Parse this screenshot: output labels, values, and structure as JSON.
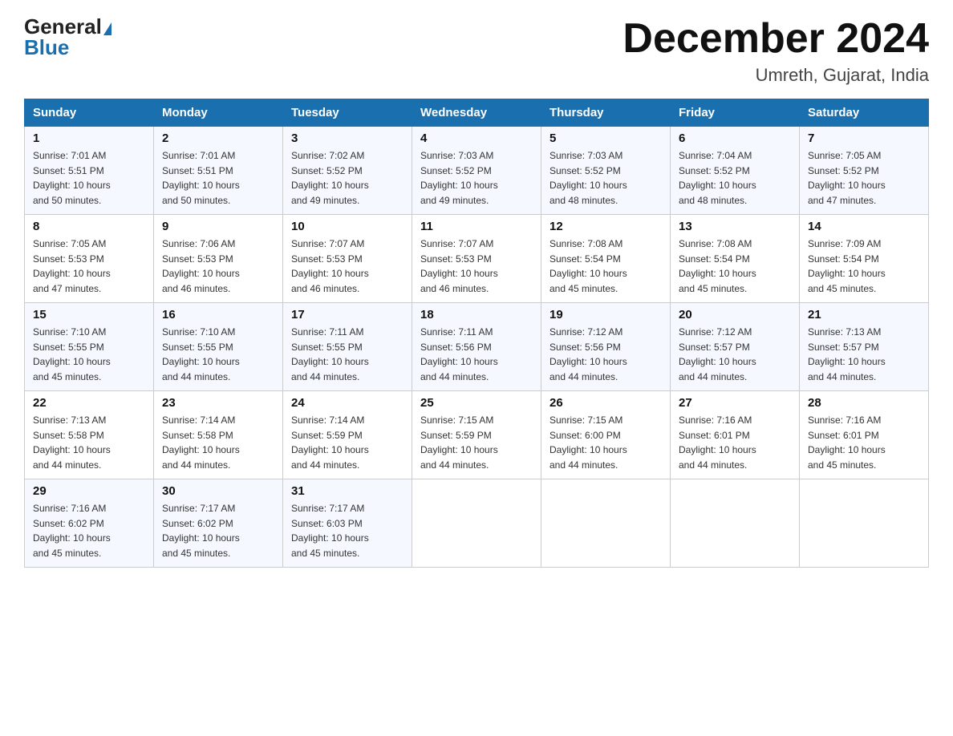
{
  "header": {
    "logo_general": "General",
    "logo_blue": "Blue",
    "month_title": "December 2024",
    "location": "Umreth, Gujarat, India"
  },
  "weekdays": [
    "Sunday",
    "Monday",
    "Tuesday",
    "Wednesday",
    "Thursday",
    "Friday",
    "Saturday"
  ],
  "weeks": [
    [
      {
        "day": "1",
        "sunrise": "7:01 AM",
        "sunset": "5:51 PM",
        "daylight": "10 hours and 50 minutes."
      },
      {
        "day": "2",
        "sunrise": "7:01 AM",
        "sunset": "5:51 PM",
        "daylight": "10 hours and 50 minutes."
      },
      {
        "day": "3",
        "sunrise": "7:02 AM",
        "sunset": "5:52 PM",
        "daylight": "10 hours and 49 minutes."
      },
      {
        "day": "4",
        "sunrise": "7:03 AM",
        "sunset": "5:52 PM",
        "daylight": "10 hours and 49 minutes."
      },
      {
        "day": "5",
        "sunrise": "7:03 AM",
        "sunset": "5:52 PM",
        "daylight": "10 hours and 48 minutes."
      },
      {
        "day": "6",
        "sunrise": "7:04 AM",
        "sunset": "5:52 PM",
        "daylight": "10 hours and 48 minutes."
      },
      {
        "day": "7",
        "sunrise": "7:05 AM",
        "sunset": "5:52 PM",
        "daylight": "10 hours and 47 minutes."
      }
    ],
    [
      {
        "day": "8",
        "sunrise": "7:05 AM",
        "sunset": "5:53 PM",
        "daylight": "10 hours and 47 minutes."
      },
      {
        "day": "9",
        "sunrise": "7:06 AM",
        "sunset": "5:53 PM",
        "daylight": "10 hours and 46 minutes."
      },
      {
        "day": "10",
        "sunrise": "7:07 AM",
        "sunset": "5:53 PM",
        "daylight": "10 hours and 46 minutes."
      },
      {
        "day": "11",
        "sunrise": "7:07 AM",
        "sunset": "5:53 PM",
        "daylight": "10 hours and 46 minutes."
      },
      {
        "day": "12",
        "sunrise": "7:08 AM",
        "sunset": "5:54 PM",
        "daylight": "10 hours and 45 minutes."
      },
      {
        "day": "13",
        "sunrise": "7:08 AM",
        "sunset": "5:54 PM",
        "daylight": "10 hours and 45 minutes."
      },
      {
        "day": "14",
        "sunrise": "7:09 AM",
        "sunset": "5:54 PM",
        "daylight": "10 hours and 45 minutes."
      }
    ],
    [
      {
        "day": "15",
        "sunrise": "7:10 AM",
        "sunset": "5:55 PM",
        "daylight": "10 hours and 45 minutes."
      },
      {
        "day": "16",
        "sunrise": "7:10 AM",
        "sunset": "5:55 PM",
        "daylight": "10 hours and 44 minutes."
      },
      {
        "day": "17",
        "sunrise": "7:11 AM",
        "sunset": "5:55 PM",
        "daylight": "10 hours and 44 minutes."
      },
      {
        "day": "18",
        "sunrise": "7:11 AM",
        "sunset": "5:56 PM",
        "daylight": "10 hours and 44 minutes."
      },
      {
        "day": "19",
        "sunrise": "7:12 AM",
        "sunset": "5:56 PM",
        "daylight": "10 hours and 44 minutes."
      },
      {
        "day": "20",
        "sunrise": "7:12 AM",
        "sunset": "5:57 PM",
        "daylight": "10 hours and 44 minutes."
      },
      {
        "day": "21",
        "sunrise": "7:13 AM",
        "sunset": "5:57 PM",
        "daylight": "10 hours and 44 minutes."
      }
    ],
    [
      {
        "day": "22",
        "sunrise": "7:13 AM",
        "sunset": "5:58 PM",
        "daylight": "10 hours and 44 minutes."
      },
      {
        "day": "23",
        "sunrise": "7:14 AM",
        "sunset": "5:58 PM",
        "daylight": "10 hours and 44 minutes."
      },
      {
        "day": "24",
        "sunrise": "7:14 AM",
        "sunset": "5:59 PM",
        "daylight": "10 hours and 44 minutes."
      },
      {
        "day": "25",
        "sunrise": "7:15 AM",
        "sunset": "5:59 PM",
        "daylight": "10 hours and 44 minutes."
      },
      {
        "day": "26",
        "sunrise": "7:15 AM",
        "sunset": "6:00 PM",
        "daylight": "10 hours and 44 minutes."
      },
      {
        "day": "27",
        "sunrise": "7:16 AM",
        "sunset": "6:01 PM",
        "daylight": "10 hours and 44 minutes."
      },
      {
        "day": "28",
        "sunrise": "7:16 AM",
        "sunset": "6:01 PM",
        "daylight": "10 hours and 45 minutes."
      }
    ],
    [
      {
        "day": "29",
        "sunrise": "7:16 AM",
        "sunset": "6:02 PM",
        "daylight": "10 hours and 45 minutes."
      },
      {
        "day": "30",
        "sunrise": "7:17 AM",
        "sunset": "6:02 PM",
        "daylight": "10 hours and 45 minutes."
      },
      {
        "day": "31",
        "sunrise": "7:17 AM",
        "sunset": "6:03 PM",
        "daylight": "10 hours and 45 minutes."
      },
      null,
      null,
      null,
      null
    ]
  ],
  "labels": {
    "sunrise": "Sunrise:",
    "sunset": "Sunset:",
    "daylight": "Daylight:"
  }
}
